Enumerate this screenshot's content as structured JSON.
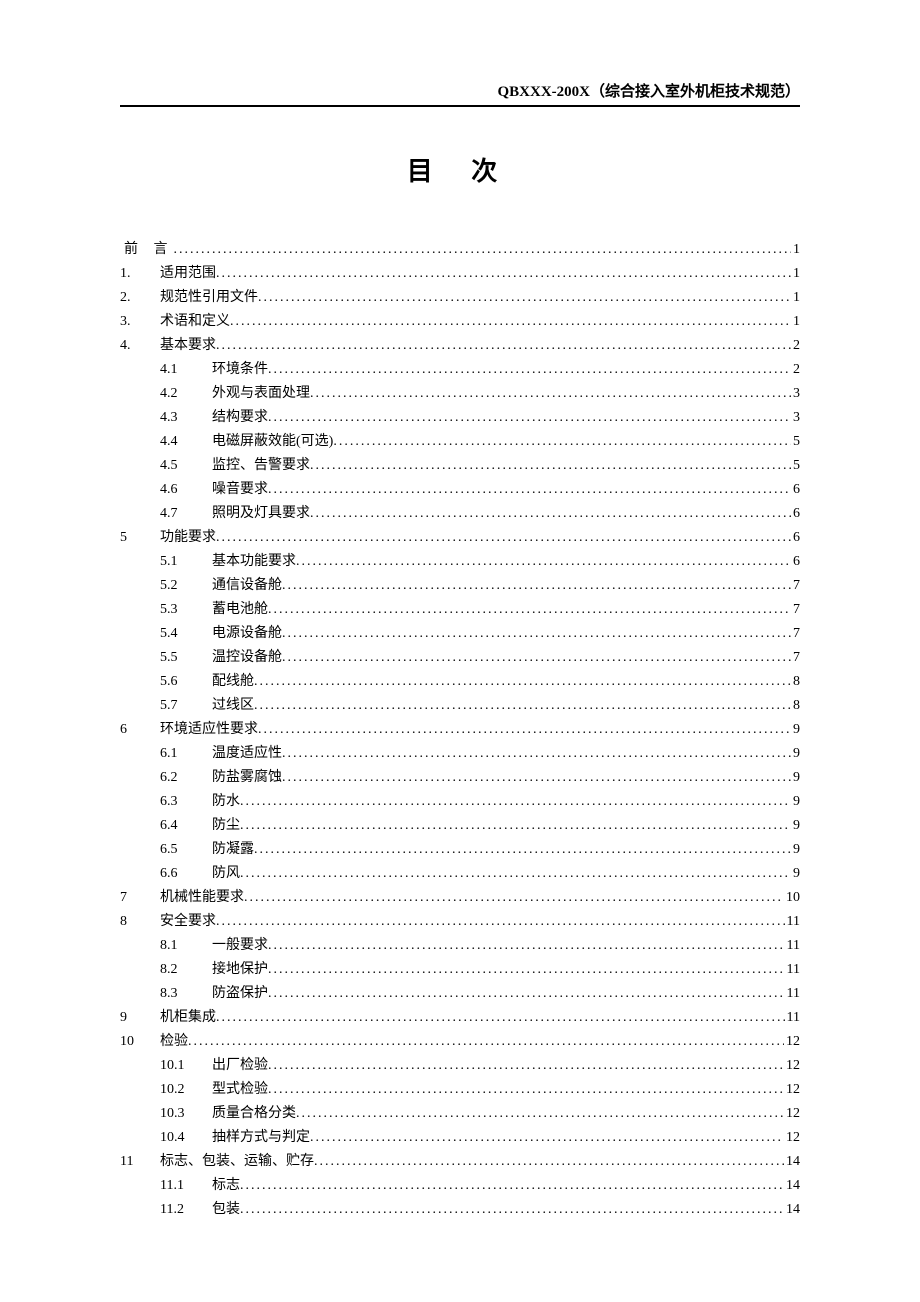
{
  "header": "QBXXX-200X（综合接入室外机柜技术规范）",
  "title": "目  次",
  "toc": [
    {
      "level": 1,
      "num": "",
      "label": "前  言",
      "page": "1",
      "lead": true
    },
    {
      "level": 1,
      "num": "1.",
      "label": "适用范围",
      "page": "1"
    },
    {
      "level": 1,
      "num": "2.",
      "label": "规范性引用文件",
      "page": "1"
    },
    {
      "level": 1,
      "num": "3.",
      "label": "术语和定义",
      "page": "1"
    },
    {
      "level": 1,
      "num": "4.",
      "label": "基本要求",
      "page": "2"
    },
    {
      "level": 2,
      "num": "4.1",
      "label": "环境条件",
      "page": "2"
    },
    {
      "level": 2,
      "num": "4.2",
      "label": "外观与表面处理",
      "page": "3"
    },
    {
      "level": 2,
      "num": "4.3",
      "label": "结构要求",
      "page": "3"
    },
    {
      "level": 2,
      "num": "4.4",
      "label": "电磁屏蔽效能(可选)",
      "page": "5"
    },
    {
      "level": 2,
      "num": "4.5",
      "label": "监控、告警要求",
      "page": "5"
    },
    {
      "level": 2,
      "num": "4.6",
      "label": "噪音要求",
      "page": "6"
    },
    {
      "level": 2,
      "num": "4.7",
      "label": "照明及灯具要求",
      "page": "6"
    },
    {
      "level": 1,
      "num": "5",
      "label": "功能要求",
      "page": "6"
    },
    {
      "level": 2,
      "num": "5.1",
      "label": "基本功能要求",
      "page": "6"
    },
    {
      "level": 2,
      "num": "5.2",
      "label": "通信设备舱",
      "page": "7"
    },
    {
      "level": 2,
      "num": "5.3",
      "label": "蓄电池舱",
      "page": "7"
    },
    {
      "level": 2,
      "num": "5.4",
      "label": "电源设备舱",
      "page": "7"
    },
    {
      "level": 2,
      "num": "5.5",
      "label": "温控设备舱",
      "page": "7"
    },
    {
      "level": 2,
      "num": "5.6",
      "label": "配线舱",
      "page": "8"
    },
    {
      "level": 2,
      "num": "5.7",
      "label": "过线区",
      "page": "8"
    },
    {
      "level": 1,
      "num": "6",
      "label": "环境适应性要求",
      "page": "9"
    },
    {
      "level": 2,
      "num": "6.1",
      "label": "温度适应性",
      "page": "9"
    },
    {
      "level": 2,
      "num": "6.2",
      "label": "防盐雾腐蚀",
      "page": "9"
    },
    {
      "level": 2,
      "num": "6.3",
      "label": "防水",
      "page": "9"
    },
    {
      "level": 2,
      "num": "6.4",
      "label": "防尘",
      "page": "9"
    },
    {
      "level": 2,
      "num": "6.5",
      "label": "防凝露",
      "page": "9"
    },
    {
      "level": 2,
      "num": "6.6",
      "label": "防风",
      "page": "9"
    },
    {
      "level": 1,
      "num": "7",
      "label": "机械性能要求",
      "page": "10"
    },
    {
      "level": 1,
      "num": "8",
      "label": "安全要求",
      "page": "11"
    },
    {
      "level": 2,
      "num": "8.1",
      "label": "一般要求",
      "page": "11"
    },
    {
      "level": 2,
      "num": "8.2",
      "label": "接地保护",
      "page": "11"
    },
    {
      "level": 2,
      "num": "8.3",
      "label": "防盗保护",
      "page": "11"
    },
    {
      "level": 1,
      "num": "9",
      "label": "机柜集成",
      "page": "11"
    },
    {
      "level": 1,
      "num": "10",
      "label": "检验",
      "page": "12"
    },
    {
      "level": 2,
      "num": "10.1",
      "label": "出厂检验",
      "page": "12"
    },
    {
      "level": 2,
      "num": "10.2",
      "label": "型式检验",
      "page": "12"
    },
    {
      "level": 2,
      "num": "10.3",
      "label": "质量合格分类",
      "page": "12"
    },
    {
      "level": 2,
      "num": "10.4",
      "label": "抽样方式与判定",
      "page": "12"
    },
    {
      "level": 1,
      "num": "11",
      "label": "标志、包装、运输、贮存",
      "page": "14"
    },
    {
      "level": 2,
      "num": "11.1",
      "label": "标志",
      "page": "14"
    },
    {
      "level": 2,
      "num": "11.2",
      "label": "包装",
      "page": "14"
    }
  ]
}
